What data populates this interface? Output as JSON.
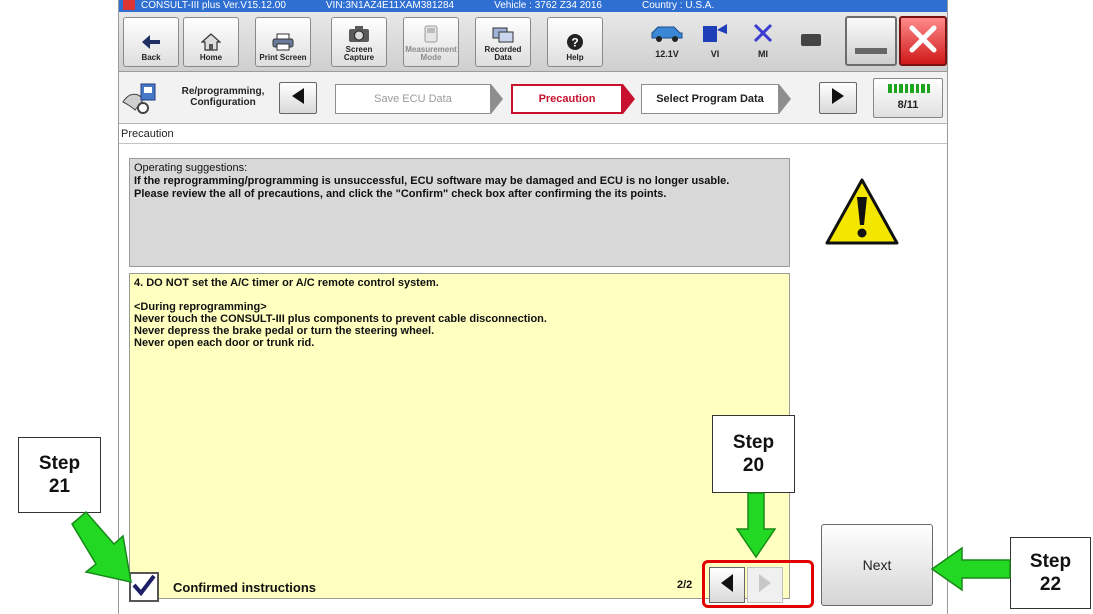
{
  "window": {
    "title_segments": [
      "CONSULT-III plus  Ver.V15.12.00",
      "VIN:3N1AZ4E11XAM381284",
      "Vehicle : 3762 Z34 2016",
      "Country : U.S.A."
    ]
  },
  "toolbar": {
    "buttons": [
      {
        "label": "Back",
        "icon": "back-arrow-icon",
        "enabled": true
      },
      {
        "label": "Home",
        "icon": "home-icon",
        "enabled": true
      },
      {
        "label": "Print Screen",
        "icon": "printer-icon",
        "enabled": true
      },
      {
        "label": "Screen Capture",
        "icon": "camera-icon",
        "enabled": true
      },
      {
        "label": "Measurement Mode",
        "icon": "measurement-icon",
        "enabled": false
      },
      {
        "label": "Recorded Data",
        "icon": "recorded-data-icon",
        "enabled": true
      },
      {
        "label": "Help",
        "icon": "help-icon",
        "enabled": true
      }
    ],
    "status": [
      {
        "label": "12.1V",
        "icon": "car-battery-icon"
      },
      {
        "label": "VI",
        "icon": "vi-connection-icon"
      },
      {
        "label": "MI",
        "icon": "mi-disconnected-icon"
      }
    ]
  },
  "breadcrumb": {
    "title": "Re/programming, Configuration",
    "steps": {
      "previous": "Save ECU Data",
      "current": "Precaution",
      "next": "Select Program Data"
    },
    "progress": {
      "current": 8,
      "total": 11,
      "text": "8/11"
    }
  },
  "section": {
    "title": "Precaution"
  },
  "suggestions": {
    "heading": "Operating  suggestions:",
    "lines": [
      "If the reprogramming/programming is unsuccessful, ECU software may be damaged and ECU is no longer usable.",
      "Please review the all of precautions, and click the \"Confirm\" check box after confirming the its points."
    ]
  },
  "details": {
    "item": "4. DO NOT set the A/C timer or A/C remote control system.",
    "subheading": "<During  reprogramming>",
    "lines": [
      "Never touch the CONSULT-III plus components to prevent cable disconnection.",
      "Never depress the brake pedal or turn the steering wheel.",
      "Never open each door or trunk rid."
    ]
  },
  "confirm": {
    "label": "Confirmed instructions",
    "checked": true
  },
  "pagination": {
    "text": "2/2",
    "current": 2,
    "total": 2
  },
  "next_button": {
    "label": "Next"
  },
  "annotations": {
    "step20": [
      "Step",
      "20"
    ],
    "step21": [
      "Step",
      "21"
    ],
    "step22": [
      "Step",
      "22"
    ]
  },
  "colors": {
    "title_bar": "#2f6fd2",
    "current_step": "#c8112e",
    "details_bg": "#ffffc0",
    "callout_arrow": "#22d822",
    "highlight": "#e00000"
  }
}
